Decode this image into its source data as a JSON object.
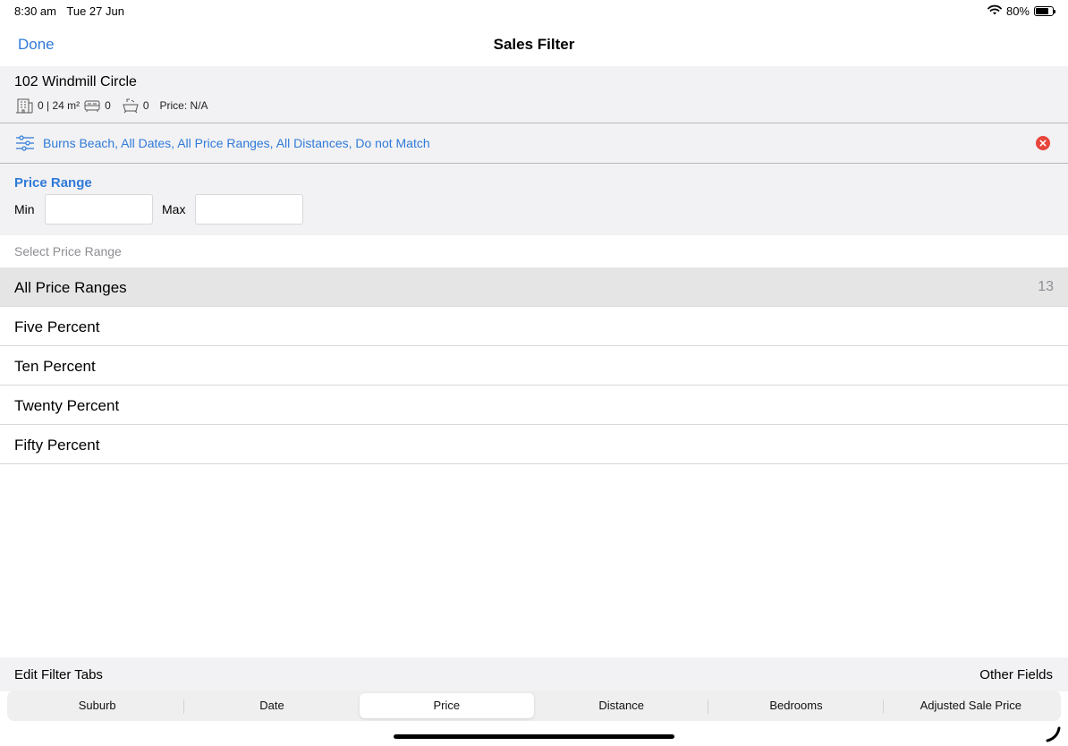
{
  "status": {
    "time": "8:30 am",
    "date": "Tue 27 Jun",
    "battery": "80%"
  },
  "nav": {
    "done_label": "Done",
    "title": "Sales Filter"
  },
  "property": {
    "address": "102 Windmill Circle",
    "area": "0 | 24 m²",
    "bedrooms": "0",
    "bathrooms": "0",
    "price": "Price: N/A"
  },
  "filter": {
    "summary": "Burns Beach, All Dates, All Price Ranges, All Distances, Do not Match"
  },
  "price_range": {
    "heading": "Price Range",
    "min_label": "Min",
    "max_label": "Max",
    "min_value": "",
    "max_value": ""
  },
  "select": {
    "header": "Select Price Range",
    "options": [
      {
        "label": "All Price Ranges",
        "count": "13"
      },
      {
        "label": "Five Percent",
        "count": ""
      },
      {
        "label": "Ten Percent",
        "count": ""
      },
      {
        "label": "Twenty Percent",
        "count": ""
      },
      {
        "label": "Fifty Percent",
        "count": ""
      }
    ]
  },
  "bottom": {
    "edit_label": "Edit Filter Tabs",
    "other_label": "Other Fields"
  },
  "tabs": [
    {
      "label": "Suburb"
    },
    {
      "label": "Date"
    },
    {
      "label": "Price"
    },
    {
      "label": "Distance"
    },
    {
      "label": "Bedrooms"
    },
    {
      "label": "Adjusted Sale Price"
    }
  ],
  "colors": {
    "accent": "#2f7ad8",
    "clear": "#e8453c",
    "panel": "#f2f2f4",
    "selected_row": "#e5e5e6"
  },
  "icons": [
    "wifi-icon",
    "battery-icon",
    "building-icon",
    "bed-icon",
    "bath-icon",
    "filter-sliders-icon",
    "clear-icon",
    "phone-icon"
  ]
}
